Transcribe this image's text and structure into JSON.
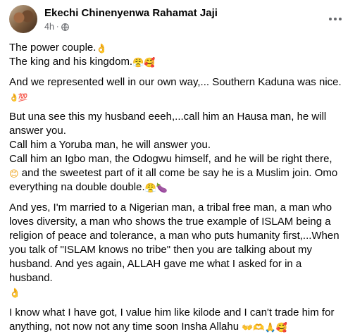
{
  "post": {
    "author": "Ekechi Chinenyenwa Rahamat Jaji",
    "time": "4h",
    "separator": "·",
    "icons": {
      "privacy": "globe-icon",
      "menu": "more-options-icon"
    }
  },
  "body": {
    "l1_text": "The power couple.",
    "l1_emoji": "👌",
    "l2_text": "The king and his kingdom.",
    "l2_emoji": "😤🥰",
    "l3_text": "And we represented well in our own way,... Southern Kaduna was nice.",
    "l3_emoji": "👌💯",
    "l4": "But una see this my husband eeeh,...call him an Hausa man, he will",
    "l5": "answer you.",
    "l6": "Call him a Yoruba man, he will answer you.",
    "l7": "Call him an Igbo man, the Odogwu himself, and he will be right there,",
    "l8_emoji": "😊",
    "l8_text": "and the sweetest part of it all come be say he is a Muslim join. Omo",
    "l9_text": "everything na double double.",
    "l9_emoji": "😤🍆",
    "l10": "And yes, I'm married to a Nigerian man, a tribal free man, a man who",
    "l11": "loves diversity, a man who shows the true example of ISLAM being a",
    "l12": "religion of peace and tolerance, a man who puts humanity first,...When",
    "l13": "you talk of \"ISLAM knows no tribe\" then you are talking about my",
    "l14_text": "husband. And yes again, ALLAH gave me what I asked for in a husband.",
    "l14_emoji": "👌",
    "l15": "I know what I have got, I value him like kilode and I can't trade him for",
    "l16_text": "anything, not now not any time soon Insha Allahu",
    "l16_emoji": "👐🫶🙏🥰"
  }
}
